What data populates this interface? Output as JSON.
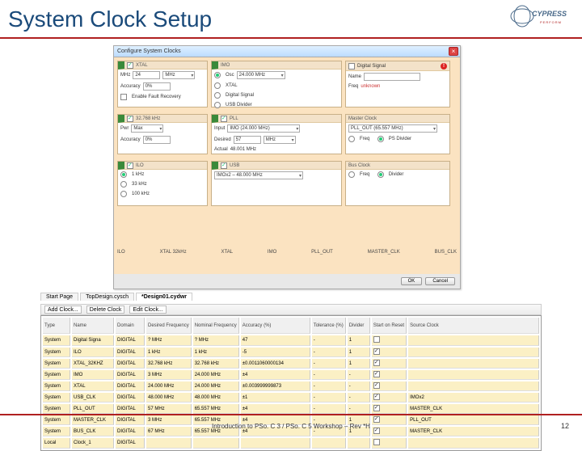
{
  "slide": {
    "title": "System Clock Setup",
    "footer": "Introduction to PSo. C 3 / PSo. C 5 Workshop – Rev *H",
    "page": "12"
  },
  "logo": {
    "brand": "CYPRESS",
    "tagline": "PERFORM"
  },
  "dialog": {
    "title": "Configure System Clocks",
    "xtal": {
      "title": "XTAL",
      "mhz_label": "MHz",
      "mhz_value": "24",
      "unit": "MHz",
      "accuracy_label": "Accuracy",
      "accuracy_value": "0%",
      "enable_label": "Enable Fault Recovery"
    },
    "imo": {
      "title": "IMO",
      "osc_label": "Osc",
      "osc_value": "24.000 MHz",
      "opts": [
        "OSC",
        "XTAL",
        "Digital Signal",
        "USB Divider"
      ]
    },
    "dsig": {
      "title": "Digital Signal",
      "name_label": "Name",
      "freq_label": "Freq",
      "freq_value": "unknown"
    },
    "khz32": {
      "title": "32.768 kHz",
      "pwr_label": "Pwr",
      "pwr_value": "Max",
      "acc_label": "Accuracy",
      "acc_value": "0%"
    },
    "pll": {
      "title": "PLL",
      "input_label": "Input",
      "input_value": "IMO (24.000 MHz)",
      "desired_label": "Desired",
      "desired_value": "57",
      "unit": "MHz",
      "actual_label": "Actual",
      "actual_value": "48.001 MHz"
    },
    "master": {
      "title": "Master Clock",
      "src_value": "PLL_OUT (65.557 MHz)",
      "freq_label": "Freq",
      "div_label": "PS Divider"
    },
    "ilo": {
      "title": "ILO",
      "opts": [
        "1 kHz",
        "33 kHz",
        "100 kHz"
      ]
    },
    "usb": {
      "title": "USB",
      "src_value": "IMOx2 – 48.000 MHz"
    },
    "bus": {
      "title": "Bus Clock",
      "opts": [
        "Freq",
        "Divider"
      ]
    },
    "foot": [
      "ILO",
      "XTAL 32kHz",
      "XTAL",
      "IMO",
      "PLL_OUT",
      "MASTER_CLK",
      "BUS_CLK"
    ],
    "ok": "OK",
    "cancel": "Cancel"
  },
  "tabs": {
    "t1": "Start Page",
    "t2": "TopDesign.cysch",
    "t3": "*Design01.cydwr"
  },
  "subbar": {
    "add": "Add Clock...",
    "del": "Delete Clock",
    "edit": "Edit Clock..."
  },
  "cols": {
    "type": "Type",
    "name": "Name",
    "domain": "Domain",
    "des": "Desired\nFrequency",
    "nom": "Nominal\nFrequency",
    "acc": "Accuracy\n(%)",
    "tol": "Tolerance\n(%)",
    "div": "Divider",
    "sh": "Start on\nReset",
    "src": "Source Clock"
  },
  "rows": [
    {
      "type": "System",
      "name": "Digital Signa",
      "domain": "DIGITAL",
      "des": "? MHz",
      "nom": "? MHz",
      "acc": "47",
      "tol": "-",
      "div": "1",
      "sh": false,
      "src": ""
    },
    {
      "type": "System",
      "name": "ILO",
      "domain": "DIGITAL",
      "des": "1 kHz",
      "nom": "1 kHz",
      "acc": "-5",
      "tol": "-",
      "div": "1",
      "sh": true,
      "src": ""
    },
    {
      "type": "System",
      "name": "XTAL_32KHZ",
      "domain": "DIGITAL",
      "des": "32.768 kHz",
      "nom": "32.768 kHz",
      "acc": "±0.0011060000134",
      "tol": "-",
      "div": "1",
      "sh": true,
      "src": ""
    },
    {
      "type": "System",
      "name": "IMO",
      "domain": "DIGITAL",
      "des": "3 MHz",
      "nom": "24.000 MHz",
      "acc": "±4",
      "tol": "-",
      "div": "-",
      "sh": true,
      "src": ""
    },
    {
      "type": "System",
      "name": "XTAL",
      "domain": "DIGITAL",
      "des": "24.000 MHz",
      "nom": "24.000 MHz",
      "acc": "±0.003999999873",
      "tol": "-",
      "div": "-",
      "sh": true,
      "src": ""
    },
    {
      "type": "System",
      "name": "USB_CLK",
      "domain": "DIGITAL",
      "des": "48.000 MHz",
      "nom": "48.000 MHz",
      "acc": "±1",
      "tol": "-",
      "div": "-",
      "sh": true,
      "src": "IMOx2"
    },
    {
      "type": "System",
      "name": "PLL_OUT",
      "domain": "DIGITAL",
      "des": "57 MHz",
      "nom": "65.557 MHz",
      "acc": "±4",
      "tol": "-",
      "div": "-",
      "sh": true,
      "src": "MASTER_CLK"
    },
    {
      "type": "System",
      "name": "MASTER_CLK",
      "domain": "DIGITAL",
      "des": "3 MHz",
      "nom": "65.557 MHz",
      "acc": "±4",
      "tol": "-",
      "div": "1",
      "sh": true,
      "src": "PLL_OUT"
    },
    {
      "type": "System",
      "name": "BUS_CLK",
      "domain": "DIGITAL",
      "des": "67 MHz",
      "nom": "65.557 MHz",
      "acc": "±4",
      "tol": "-",
      "div": "1",
      "sh": true,
      "src": "MASTER_CLK"
    },
    {
      "type": "Local",
      "name": "Clock_1",
      "domain": "DIGITAL",
      "des": "",
      "nom": "",
      "acc": "",
      "tol": "",
      "div": "",
      "sh": false,
      "src": ""
    }
  ]
}
